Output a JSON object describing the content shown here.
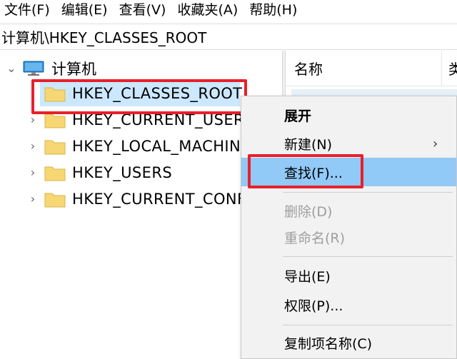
{
  "menubar": {
    "items": [
      "文件(F)",
      "编辑(E)",
      "查看(V)",
      "收藏夹(A)",
      "帮助(H)"
    ]
  },
  "address": {
    "path": "计算机\\HKEY_CLASSES_ROOT"
  },
  "tree": {
    "root": {
      "label": "计算机",
      "expander": "⌄",
      "icon": "computer-icon"
    },
    "items": [
      {
        "label": "HKEY_CLASSES_ROOT",
        "expander": "›",
        "selected": true,
        "icon": "folder-icon"
      },
      {
        "label": "HKEY_CURRENT_USER",
        "expander": "›",
        "icon": "folder-icon"
      },
      {
        "label": "HKEY_LOCAL_MACHINE",
        "expander": "›",
        "icon": "folder-icon"
      },
      {
        "label": "HKEY_USERS",
        "expander": "›",
        "icon": "folder-icon"
      },
      {
        "label": "HKEY_CURRENT_CONFIG",
        "expander": "›",
        "icon": "folder-icon"
      }
    ]
  },
  "list": {
    "columns": [
      "名称",
      "类"
    ]
  },
  "context_menu": {
    "items": [
      {
        "label": "展开",
        "bold": true
      },
      {
        "label": "新建(N)",
        "submenu_arrow": "›"
      },
      {
        "label": "查找(F)...",
        "hover": true
      },
      {
        "label": "删除(D)",
        "disabled": true
      },
      {
        "label": "重命名(R)",
        "disabled": true
      },
      {
        "label": "导出(E)"
      },
      {
        "label": "权限(P)..."
      },
      {
        "label": "复制项名称(C)"
      }
    ]
  },
  "colors": {
    "highlight_box": "#e8202b",
    "selection": "#cce8ff",
    "menu_hover": "#91c9f7",
    "folder": "#f7d774",
    "menu_bg": "#f2f2f2"
  }
}
